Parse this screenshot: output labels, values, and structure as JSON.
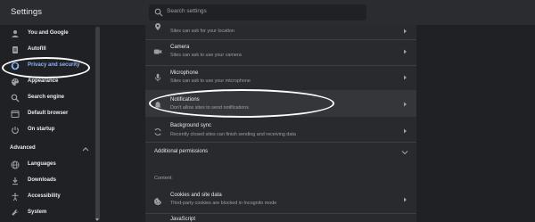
{
  "app": {
    "title": "Settings"
  },
  "search": {
    "placeholder": "Search settings"
  },
  "sidebar": {
    "items": [
      {
        "label": "You and Google",
        "icon": "person-icon"
      },
      {
        "label": "Autofill",
        "icon": "clipboard-icon"
      },
      {
        "label": "Privacy and security",
        "icon": "shield-icon",
        "active": true
      },
      {
        "label": "Appearance",
        "icon": "palette-icon"
      },
      {
        "label": "Search engine",
        "icon": "search-icon"
      },
      {
        "label": "Default browser",
        "icon": "browser-icon"
      },
      {
        "label": "On startup",
        "icon": "power-icon"
      }
    ],
    "advanced": {
      "label": "Advanced"
    },
    "advanced_items": [
      {
        "label": "Languages",
        "icon": "globe-icon"
      },
      {
        "label": "Downloads",
        "icon": "download-icon"
      },
      {
        "label": "Accessibility",
        "icon": "accessibility-icon"
      },
      {
        "label": "System",
        "icon": "wrench-icon"
      }
    ]
  },
  "main": {
    "rows": [
      {
        "title": "",
        "subtitle": "Sites can ask for your location",
        "icon": "location-icon"
      },
      {
        "title": "Camera",
        "subtitle": "Sites can ask to use your camera",
        "icon": "camera-icon"
      },
      {
        "title": "Microphone",
        "subtitle": "Sites can ask to use your microphone",
        "icon": "microphone-icon"
      },
      {
        "title": "Notifications",
        "subtitle": "Don't allow sites to send notifications",
        "icon": "bell-icon"
      },
      {
        "title": "Background sync",
        "subtitle": "Recently closed sites can finish sending and receiving data",
        "icon": "sync-icon"
      }
    ],
    "additional_permissions": "Additional permissions",
    "content_label": "Content",
    "content_rows": [
      {
        "title": "Cookies and site data",
        "subtitle": "Third-party cookies are blocked in Incognito mode",
        "icon": "cookie-icon"
      },
      {
        "title": "JavaScript",
        "subtitle": "",
        "icon": "code-icon"
      }
    ]
  },
  "colors": {
    "background": "#202124",
    "panel": "#292a2d",
    "accent": "#8ab4f8",
    "text": "#e8eaed",
    "secondary_text": "#9aa0a6",
    "annotation": "#ffffff"
  }
}
